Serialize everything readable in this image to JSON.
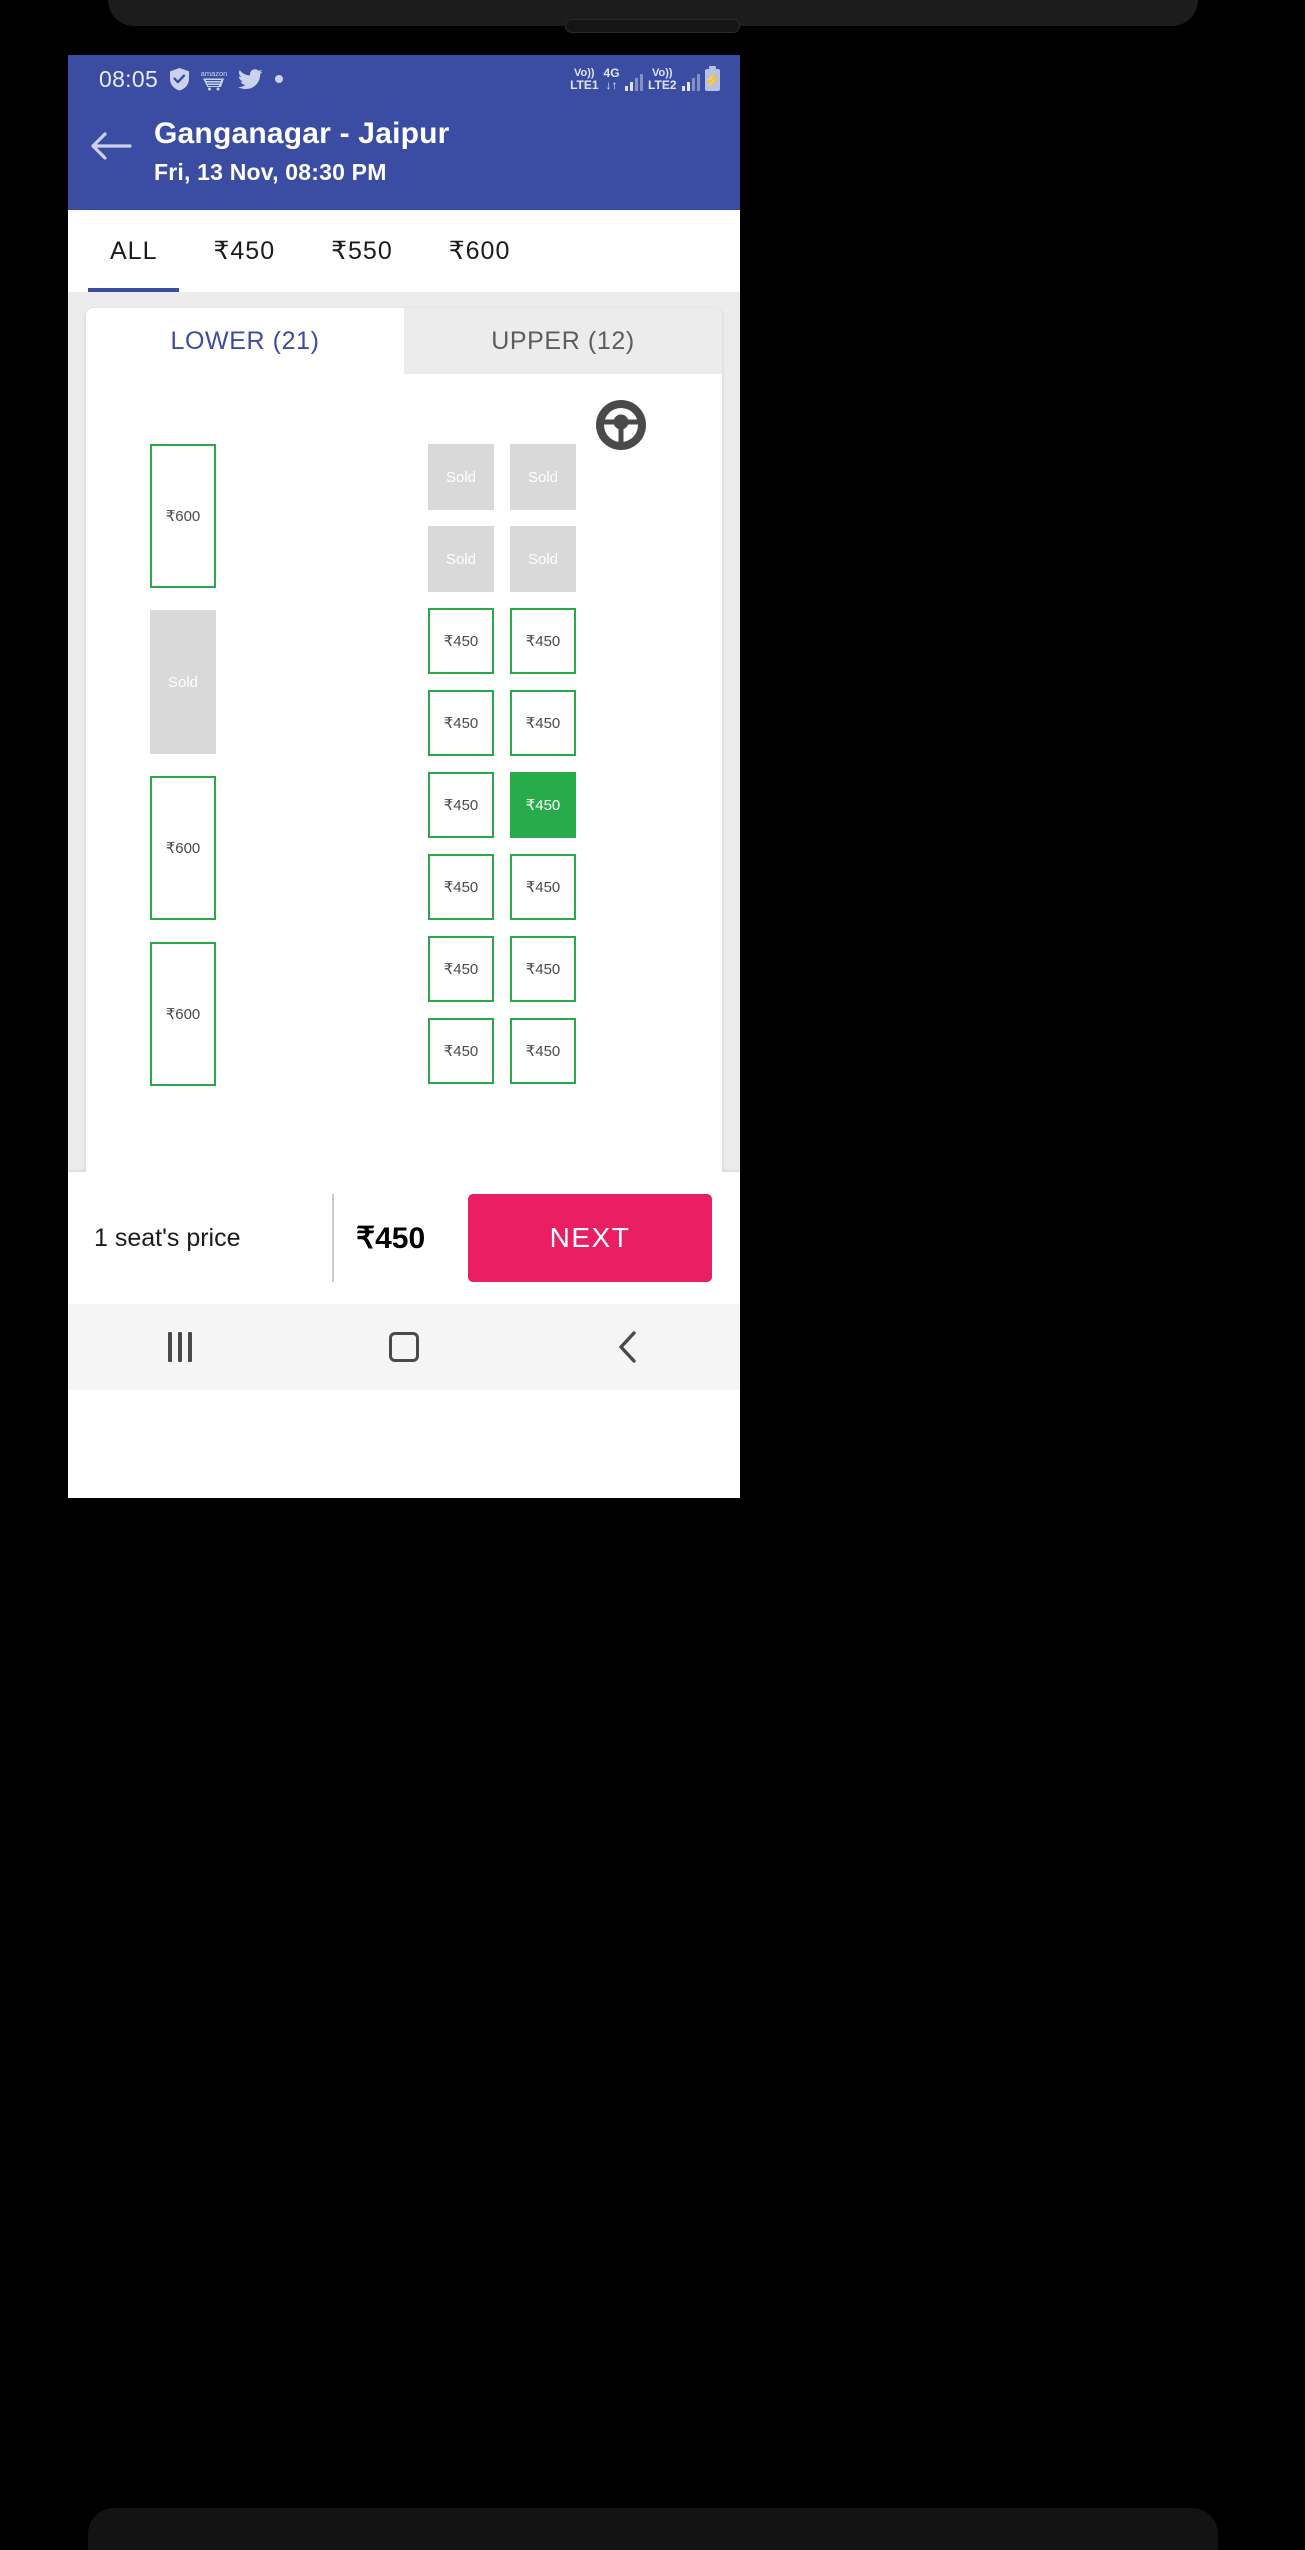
{
  "status_bar": {
    "time": "08:05",
    "left_icons": [
      "shield-check-icon",
      "amazon-cart-icon",
      "twitter-bird-icon",
      "dot-icon"
    ],
    "volte1_line1": "Vo))",
    "volte1_line2": "LTE1",
    "network_type": "4G",
    "network_arrows": "↓↑",
    "volte2_line1": "Vo))",
    "volte2_line2": "LTE2",
    "battery_glyph": "⚡"
  },
  "header": {
    "back_icon": "back-arrow-icon",
    "title": "Ganganagar - Jaipur",
    "subtitle": "Fri, 13 Nov,  08:30 PM"
  },
  "price_filter": {
    "tabs": [
      {
        "label": "ALL",
        "active": true
      },
      {
        "label": "₹450",
        "active": false
      },
      {
        "label": "₹550",
        "active": false
      },
      {
        "label": "₹600",
        "active": false
      }
    ]
  },
  "deck_tabs": [
    {
      "label": "LOWER (21)",
      "active": true
    },
    {
      "label": "UPPER (12)",
      "active": false
    }
  ],
  "driver_icon": "steering-wheel-icon",
  "seat_map": {
    "left_column": [
      {
        "label": "₹600",
        "state": "available"
      },
      {
        "label": "Sold",
        "state": "sold"
      },
      {
        "label": "₹600",
        "state": "available"
      },
      {
        "label": "₹600",
        "state": "available"
      }
    ],
    "right_column_1": [
      {
        "label": "Sold",
        "state": "sold"
      },
      {
        "label": "Sold",
        "state": "sold"
      },
      {
        "label": "₹450",
        "state": "available"
      },
      {
        "label": "₹450",
        "state": "available"
      },
      {
        "label": "₹450",
        "state": "available"
      },
      {
        "label": "₹450",
        "state": "available"
      },
      {
        "label": "₹450",
        "state": "available"
      },
      {
        "label": "₹450",
        "state": "available"
      }
    ],
    "right_column_2": [
      {
        "label": "Sold",
        "state": "sold"
      },
      {
        "label": "Sold",
        "state": "sold"
      },
      {
        "label": "₹450",
        "state": "available"
      },
      {
        "label": "₹450",
        "state": "available"
      },
      {
        "label": "₹450",
        "state": "selected"
      },
      {
        "label": "₹450",
        "state": "available"
      },
      {
        "label": "₹450",
        "state": "available"
      },
      {
        "label": "₹450",
        "state": "available"
      }
    ]
  },
  "bottom_bar": {
    "fare_label": "1 seat's price",
    "fare_amount": "₹450",
    "next_label": "NEXT"
  },
  "nav_bar": {
    "recents_icon": "recents-icon",
    "home_icon": "home-icon",
    "back_icon": "back-chevron-icon"
  },
  "colors": {
    "brand_blue": "#3a4da2",
    "accent_pink": "#e91e63",
    "seat_green": "#2aa84a",
    "selected_green": "#27ab4b",
    "sold_gray": "#d9d9d9"
  }
}
